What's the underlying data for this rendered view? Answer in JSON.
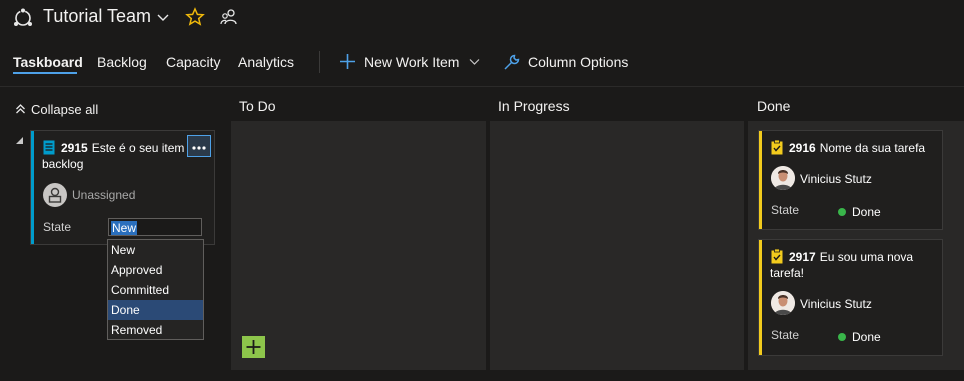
{
  "header": {
    "team_name": "Tutorial Team"
  },
  "tabs": [
    {
      "label": "Taskboard"
    },
    {
      "label": "Backlog"
    },
    {
      "label": "Capacity"
    },
    {
      "label": "Analytics"
    }
  ],
  "toolbar": {
    "new_work_item": "New Work Item",
    "column_options": "Column Options"
  },
  "board": {
    "collapse_all": "Collapse all",
    "columns": [
      {
        "label": "To Do"
      },
      {
        "label": "In Progress"
      },
      {
        "label": "Done"
      }
    ]
  },
  "backlog_item": {
    "id": "2915",
    "title": "Este é o seu item backlog",
    "assignee": "Unassigned",
    "state_label": "State",
    "state_value": "New",
    "state_options": [
      "New",
      "Approved",
      "Committed",
      "Done",
      "Removed"
    ],
    "highlighted_option": "Done"
  },
  "done_cards": [
    {
      "id": "2916",
      "title": "Nome da sua tarefa",
      "assignee": "Vinicius Stutz",
      "state_label": "State",
      "state_value": "Done"
    },
    {
      "id": "2917",
      "title": "Eu sou uma nova tarefa!",
      "assignee": "Vinicius Stutz",
      "state_label": "State",
      "state_value": "Done"
    }
  ],
  "colors": {
    "accent": "#4ea1e8",
    "backlog_bar": "#009ccc",
    "task_bar": "#f2cb1d",
    "done_dot": "#39b54a",
    "add_button": "#8dc54b"
  }
}
